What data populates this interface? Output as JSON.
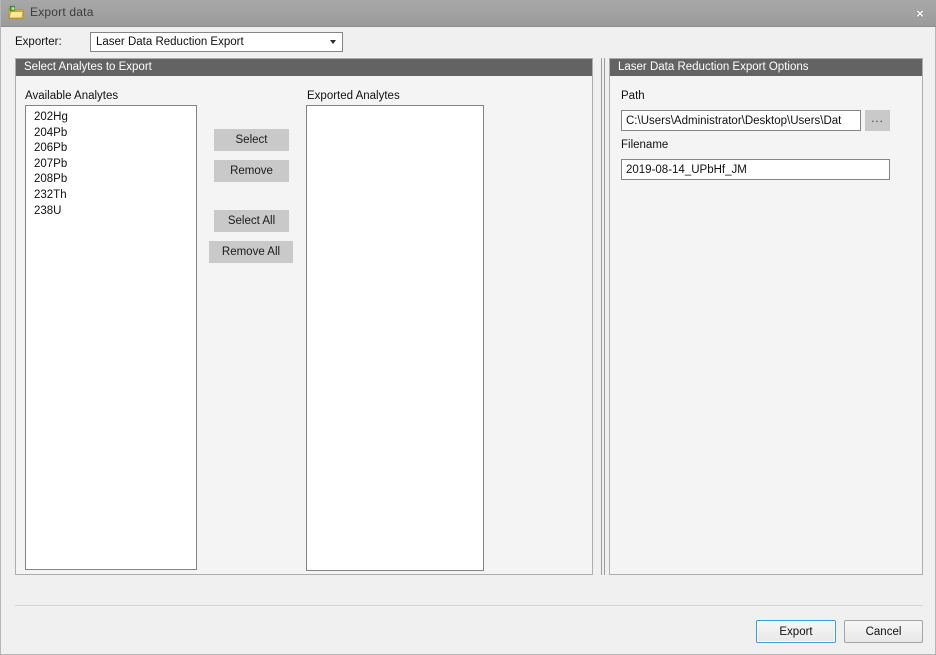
{
  "window": {
    "title": "Export data",
    "icon": "export-folder-icon",
    "close_label": "×",
    "accent_focus_color": "#3c9bdb",
    "titlebar_color": "#a1a1a1",
    "group_header_color": "#636363"
  },
  "exporter": {
    "label": "Exporter:",
    "selected": "Laser Data Reduction Export",
    "options": [
      "Laser Data Reduction Export"
    ]
  },
  "left_panel": {
    "header": "Select Analytes to Export",
    "available": {
      "label": "Available Analytes",
      "items": [
        "202Hg",
        "204Pb",
        "206Pb",
        "207Pb",
        "208Pb",
        "232Th",
        "238U"
      ]
    },
    "exported": {
      "label": "Exported Analytes",
      "items": []
    },
    "buttons": {
      "select": "Select",
      "remove": "Remove",
      "select_all": "Select All",
      "remove_all": "Remove All"
    }
  },
  "right_panel": {
    "header": "Laser Data Reduction Export Options",
    "path": {
      "label": "Path",
      "value": "C:\\Users\\Administrator\\Desktop\\Users\\Dat",
      "placeholder": "",
      "browse_label": "..."
    },
    "filename": {
      "label": "Filename",
      "value": "2019-08-14_UPbHf_JM",
      "placeholder": ""
    }
  },
  "footer": {
    "export_label": "Export",
    "cancel_label": "Cancel"
  }
}
